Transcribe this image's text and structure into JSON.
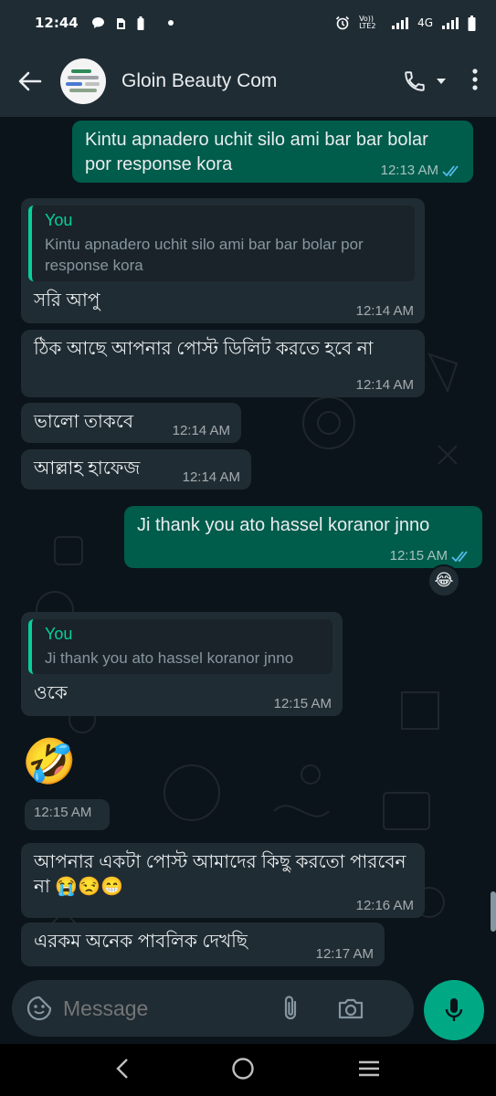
{
  "status_bar": {
    "time": "12:44",
    "volte": "Vo)) LTE2",
    "network": "4G"
  },
  "header": {
    "contact_name": "Gloin Beauty Com"
  },
  "messages": [
    {
      "direction": "outgoing",
      "text": "Kintu apnadero uchit silo ami bar bar bolar por response kora",
      "time": "12:13 AM"
    },
    {
      "direction": "incoming",
      "quote_name": "You",
      "quote_text": "Kintu apnadero uchit silo ami bar bar bolar por response kora",
      "text": "সরি আপু",
      "time": "12:14 AM"
    },
    {
      "direction": "incoming",
      "text": "ঠিক আছে  আপনার  পোস্ট ডিলিট করতে হবে না",
      "time": "12:14 AM"
    },
    {
      "direction": "incoming",
      "text": "ভালো  তাকবে",
      "time": "12:14 AM"
    },
    {
      "direction": "incoming",
      "text": "আল্লাহ হাফেজ",
      "time": "12:14 AM"
    },
    {
      "direction": "outgoing",
      "text": "Ji thank you ato hassel koranor jnno",
      "time": "12:15 AM",
      "reaction": "😂"
    },
    {
      "direction": "incoming",
      "quote_name": "You",
      "quote_text": "Ji thank you ato hassel koranor jnno",
      "text": "ওকে",
      "time": "12:15 AM"
    },
    {
      "direction": "incoming",
      "emoji_only": "🤣",
      "time": "12:15 AM"
    },
    {
      "direction": "incoming",
      "text": "আপনার  একটা  পোস্ট  আমাদের কিছু করতো পারবেন না",
      "emojis": [
        "😭",
        "😒",
        "😁"
      ],
      "time": "12:16 AM"
    },
    {
      "direction": "incoming",
      "text": "এরকম  অনেক  পাবলিক  দেখছি",
      "time": "12:17 AM"
    }
  ],
  "composer": {
    "placeholder": "Message"
  },
  "colors": {
    "background": "#0b141a",
    "header": "#1f2c34",
    "incoming_bubble": "#202c33",
    "outgoing_bubble": "#005c4b",
    "accent": "#00a884",
    "quote_name": "#06cf9c",
    "read_tick": "#53bdeb"
  }
}
